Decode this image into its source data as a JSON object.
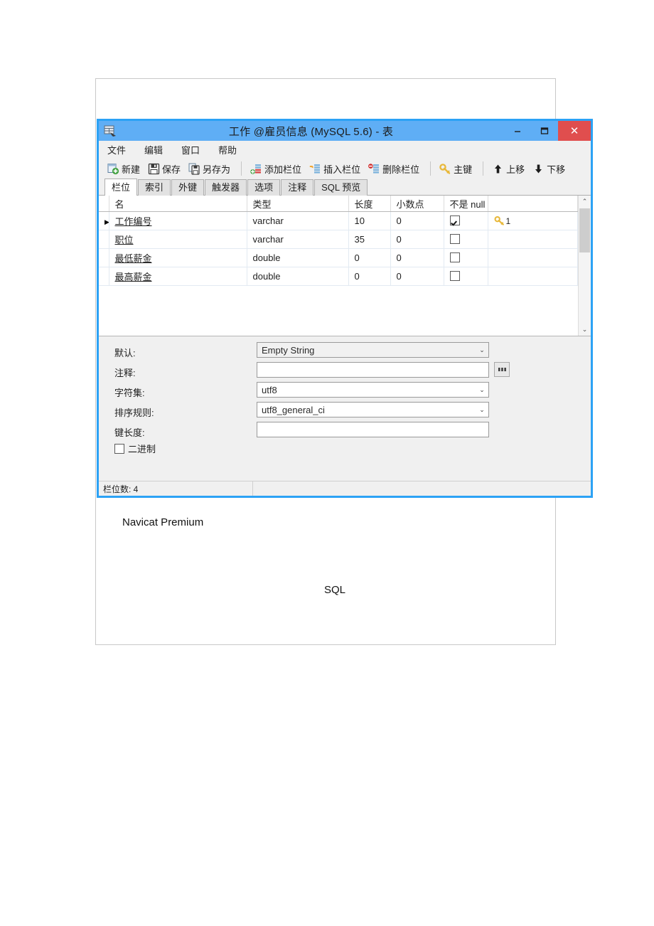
{
  "document": {
    "paragraphs": [
      {
        "text": "Navicat Premium"
      },
      {
        "text": "SQL"
      }
    ]
  },
  "window": {
    "title": "工作 @雇员信息 (MySQL 5.6) - 表",
    "app_icon": "table-designer-icon",
    "controls": {
      "minimize": "−",
      "maximize": "❐",
      "close": "✕"
    },
    "accent_color": "#5faef5",
    "close_color": "#e04e4e"
  },
  "menubar": {
    "items": [
      {
        "label": "文件"
      },
      {
        "label": "编辑"
      },
      {
        "label": "窗口"
      },
      {
        "label": "帮助"
      }
    ]
  },
  "toolbar": {
    "buttons": [
      {
        "label": "新建",
        "icon": "new-document-icon"
      },
      {
        "label": "保存",
        "icon": "save-disk-icon"
      },
      {
        "label": "另存为",
        "icon": "save-as-icon"
      },
      {
        "label": "添加栏位",
        "icon": "add-field-icon"
      },
      {
        "label": "插入栏位",
        "icon": "insert-field-icon"
      },
      {
        "label": "删除栏位",
        "icon": "delete-field-icon"
      },
      {
        "label": "主键",
        "icon": "primary-key-icon"
      },
      {
        "label": "上移",
        "icon": "arrow-up-icon"
      },
      {
        "label": "下移",
        "icon": "arrow-down-icon"
      }
    ]
  },
  "tabs": [
    {
      "label": "栏位",
      "active": true
    },
    {
      "label": "索引",
      "active": false
    },
    {
      "label": "外键",
      "active": false
    },
    {
      "label": "触发器",
      "active": false
    },
    {
      "label": "选项",
      "active": false
    },
    {
      "label": "注释",
      "active": false
    },
    {
      "label": "SQL 预览",
      "active": false
    }
  ],
  "grid": {
    "columns": [
      "名",
      "类型",
      "长度",
      "小数点",
      "不是 null",
      ""
    ],
    "rows": [
      {
        "selected": true,
        "marker": "▶",
        "name": "工作编号",
        "type": "varchar",
        "length": "10",
        "decimals": "0",
        "not_null": true,
        "key": "1"
      },
      {
        "selected": false,
        "marker": "",
        "name": "职位",
        "type": "varchar",
        "length": "35",
        "decimals": "0",
        "not_null": false,
        "key": ""
      },
      {
        "selected": false,
        "marker": "",
        "name": "最低薪金",
        "type": "double",
        "length": "0",
        "decimals": "0",
        "not_null": false,
        "key": ""
      },
      {
        "selected": false,
        "marker": "",
        "name": "最高薪金",
        "type": "double",
        "length": "0",
        "decimals": "0",
        "not_null": false,
        "key": ""
      }
    ],
    "scrollbar": {
      "up_arrow": "⌃",
      "down_arrow": "⌄"
    }
  },
  "properties": {
    "default": {
      "label": "默认:",
      "value": "Empty String"
    },
    "comment": {
      "label": "注释:",
      "value": "",
      "ellipsis_label": "..."
    },
    "charset": {
      "label": "字符集:",
      "value": "utf8"
    },
    "collation": {
      "label": "排序规则:",
      "value": "utf8_general_ci"
    },
    "key_length": {
      "label": "键长度:",
      "value": ""
    },
    "binary": {
      "label": "二进制",
      "checked": false
    }
  },
  "statusbar": {
    "field_count_text": "栏位数: 4"
  }
}
